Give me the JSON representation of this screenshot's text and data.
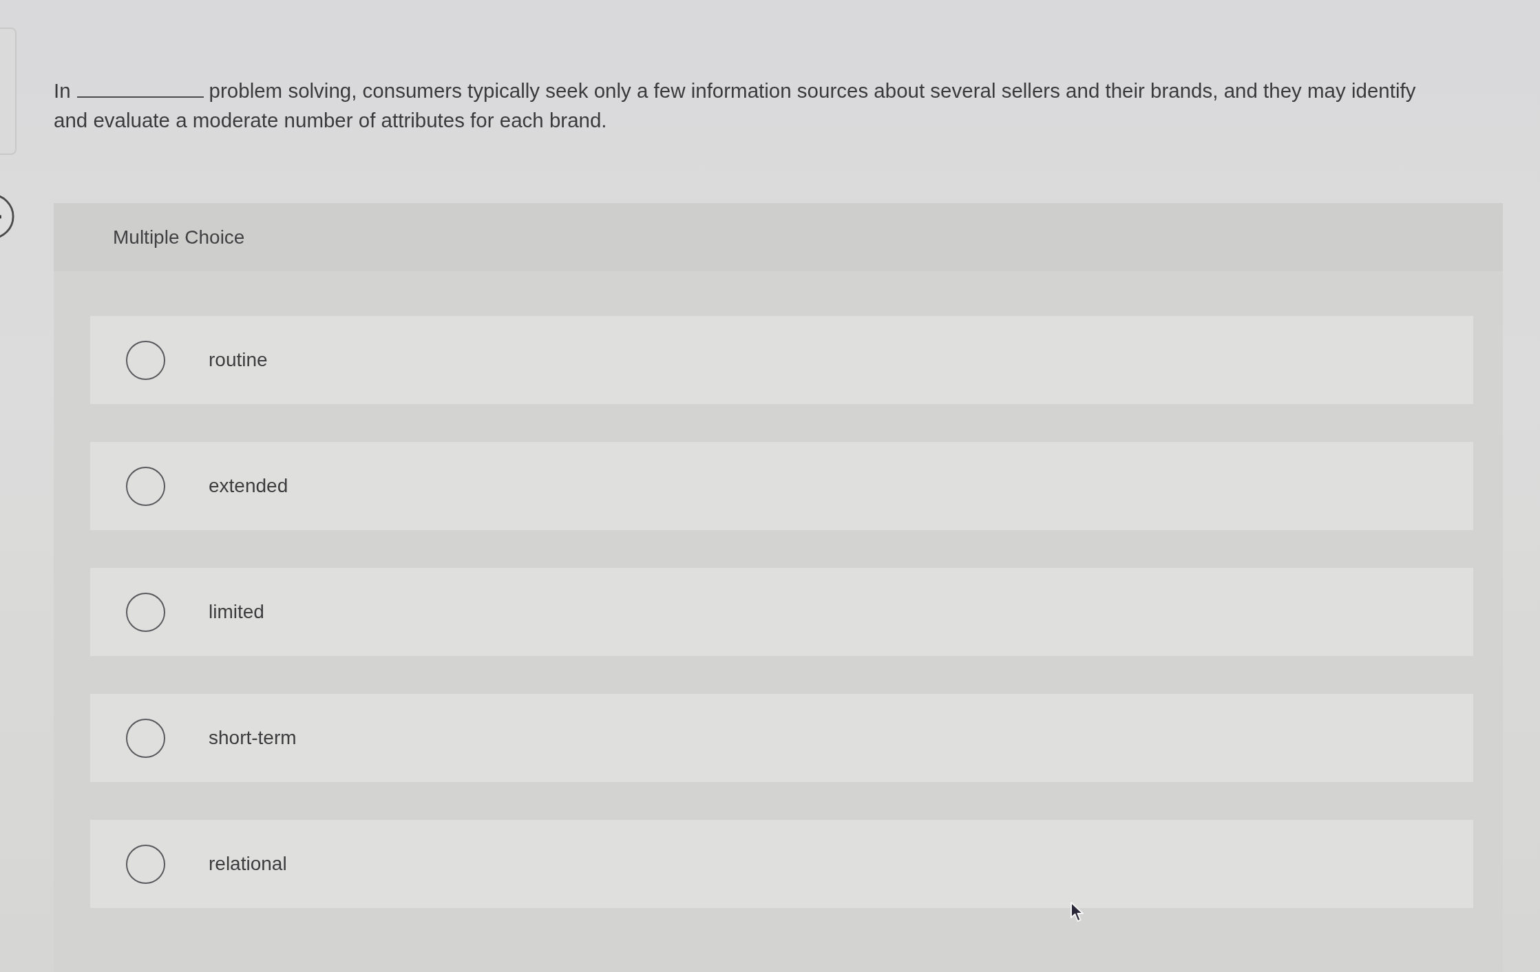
{
  "question": {
    "before_blank": "In",
    "after_blank": "problem solving, consumers typically seek only a few information sources about several sellers and their brands, and they may identify",
    "continuation": "and evaluate a moderate number of attributes for each brand."
  },
  "answer_type": "Multiple Choice",
  "options": [
    {
      "label": "routine",
      "selected": false
    },
    {
      "label": "extended",
      "selected": false
    },
    {
      "label": "limited",
      "selected": false
    },
    {
      "label": "short-term",
      "selected": false
    },
    {
      "label": "relational",
      "selected": false
    }
  ]
}
